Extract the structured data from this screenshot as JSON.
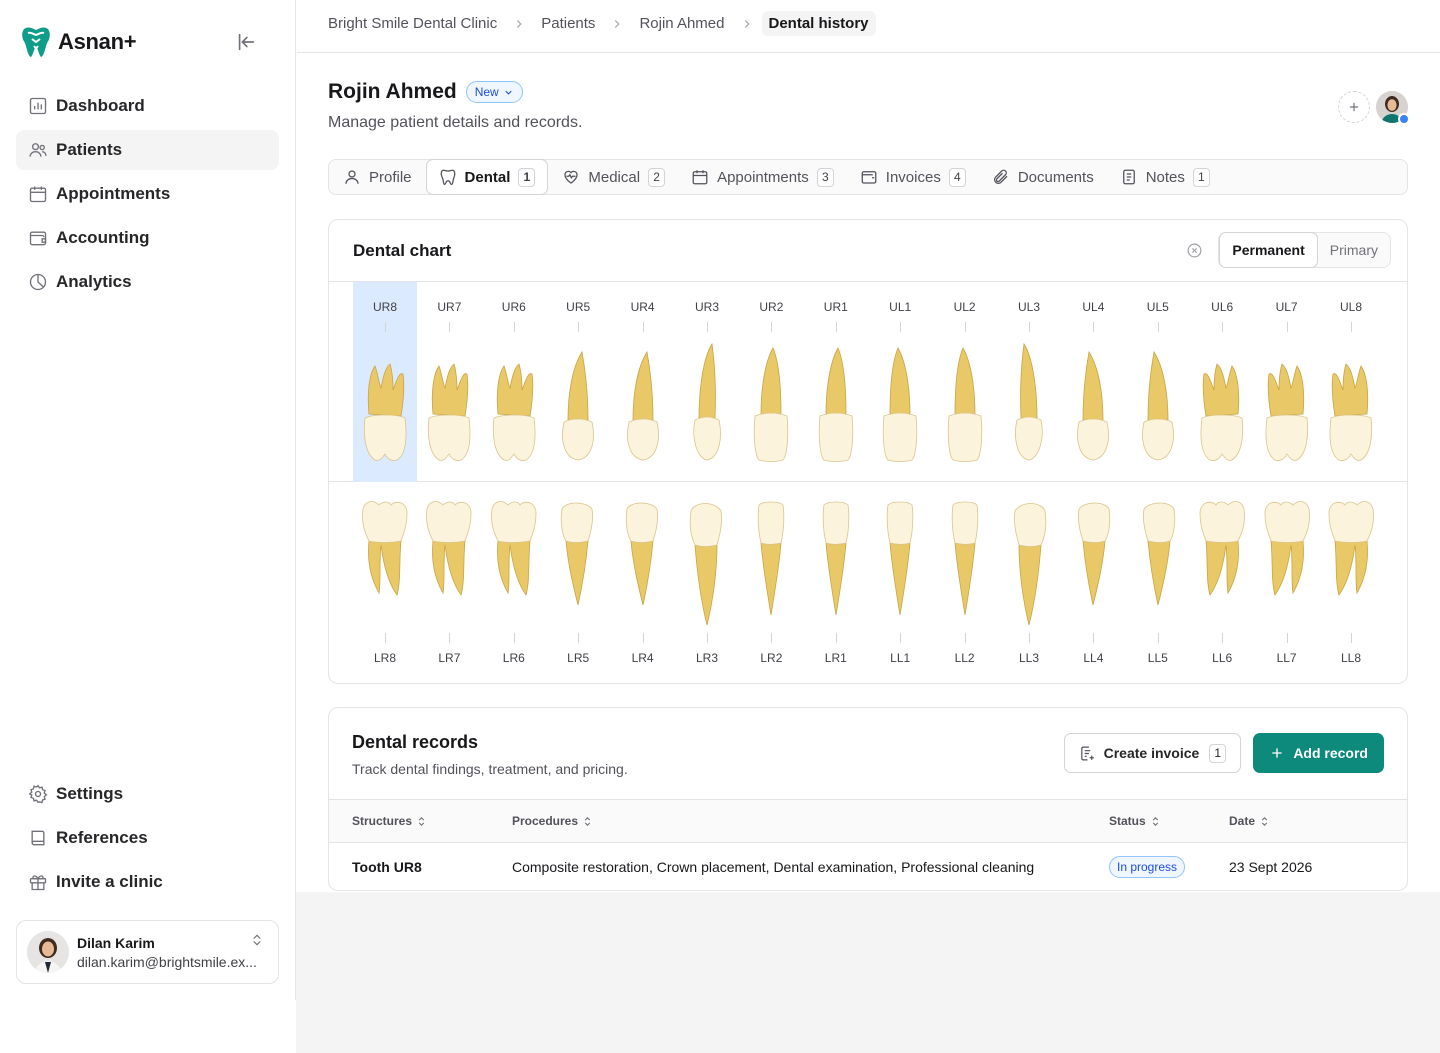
{
  "app": {
    "name": "Asnan+"
  },
  "sidebar": {
    "nav": [
      {
        "label": "Dashboard",
        "icon": "dashboard-icon"
      },
      {
        "label": "Patients",
        "icon": "users-icon",
        "active": true
      },
      {
        "label": "Appointments",
        "icon": "calendar-icon"
      },
      {
        "label": "Accounting",
        "icon": "wallet-icon"
      },
      {
        "label": "Analytics",
        "icon": "pie-chart-icon"
      }
    ],
    "bottom": [
      {
        "label": "Settings",
        "icon": "gear-icon"
      },
      {
        "label": "References",
        "icon": "book-icon"
      },
      {
        "label": "Invite a clinic",
        "icon": "gift-icon"
      }
    ],
    "user": {
      "name": "Dilan Karim",
      "email": "dilan.karim@brightsmile.ex..."
    }
  },
  "breadcrumb": [
    "Bright Smile Dental Clinic",
    "Patients",
    "Rojin Ahmed",
    "Dental history"
  ],
  "page": {
    "title": "Rojin Ahmed",
    "badge": "New",
    "subtitle": "Manage patient details and records."
  },
  "tabs": [
    {
      "label": "Profile",
      "count": null,
      "icon": "user-icon"
    },
    {
      "label": "Dental",
      "count": "1",
      "icon": "tooth-icon",
      "active": true
    },
    {
      "label": "Medical",
      "count": "2",
      "icon": "heart-pulse-icon"
    },
    {
      "label": "Appointments",
      "count": "3",
      "icon": "calendar-icon"
    },
    {
      "label": "Invoices",
      "count": "4",
      "icon": "wallet-icon"
    },
    {
      "label": "Documents",
      "count": null,
      "icon": "paperclip-icon"
    },
    {
      "label": "Notes",
      "count": "1",
      "icon": "note-icon"
    }
  ],
  "dental_chart": {
    "title": "Dental chart",
    "dentition_options": [
      "Permanent",
      "Primary"
    ],
    "selected_dentition": "Permanent",
    "upper": [
      "UR8",
      "UR7",
      "UR6",
      "UR5",
      "UR4",
      "UR3",
      "UR2",
      "UR1",
      "UL1",
      "UL2",
      "UL3",
      "UL4",
      "UL5",
      "UL6",
      "UL7",
      "UL8"
    ],
    "lower": [
      "LR8",
      "LR7",
      "LR6",
      "LR5",
      "LR4",
      "LR3",
      "LR2",
      "LR1",
      "LL1",
      "LL2",
      "LL3",
      "LL4",
      "LL5",
      "LL6",
      "LL7",
      "LL8"
    ],
    "selected_tooth": "UR8"
  },
  "records": {
    "title": "Dental records",
    "subtitle": "Track dental findings, treatment, and pricing.",
    "create_invoice_label": "Create invoice",
    "create_invoice_count": "1",
    "add_record_label": "Add record",
    "columns": [
      "Structures",
      "Procedures",
      "Status",
      "Date"
    ],
    "rows": [
      {
        "structure": "Tooth UR8",
        "procedures": "Composite restoration, Crown placement, Dental examination, Professional cleaning",
        "status": "In progress",
        "date": "23 Sept 2026"
      }
    ]
  },
  "colors": {
    "primary": "#0d8a7b",
    "selection": "#dbeafe",
    "tooth_root": "#e9c867",
    "tooth_crown": "#fbf3dc"
  }
}
